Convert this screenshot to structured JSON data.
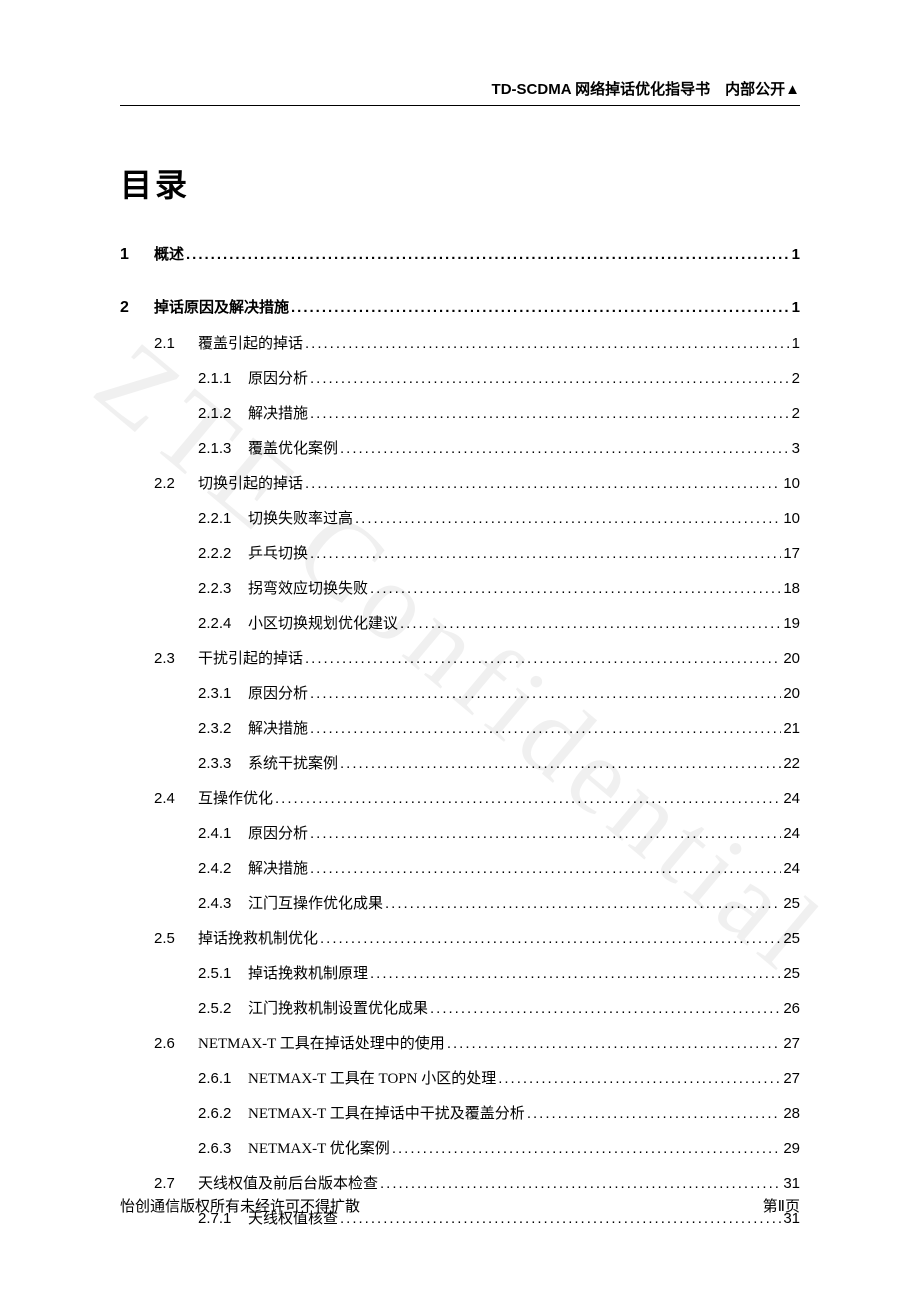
{
  "header": "TD-SCDMA 网络掉话优化指导书　内部公开▲",
  "watermark": "ZTE Confidential",
  "title": "目录",
  "toc": [
    {
      "level": 1,
      "num": "1",
      "label": "概述",
      "page": "1"
    },
    {
      "level": 1,
      "num": "2",
      "label": "掉话原因及解决措施",
      "page": "1"
    },
    {
      "level": 2,
      "num": "2.1",
      "label": "覆盖引起的掉话",
      "page": "1"
    },
    {
      "level": 3,
      "num": "2.1.1",
      "label": "原因分析",
      "page": "2"
    },
    {
      "level": 3,
      "num": "2.1.2",
      "label": "解决措施",
      "page": "2"
    },
    {
      "level": 3,
      "num": "2.1.3",
      "label": "覆盖优化案例",
      "page": "3"
    },
    {
      "level": 2,
      "num": "2.2",
      "label": "切换引起的掉话",
      "page": "10"
    },
    {
      "level": 3,
      "num": "2.2.1",
      "label": "切换失败率过高",
      "page": "10"
    },
    {
      "level": 3,
      "num": "2.2.2",
      "label": "乒乓切换",
      "page": "17"
    },
    {
      "level": 3,
      "num": "2.2.3",
      "label": "拐弯效应切换失败",
      "page": "18"
    },
    {
      "level": 3,
      "num": "2.2.4",
      "label": "小区切换规划优化建议",
      "page": "19"
    },
    {
      "level": 2,
      "num": "2.3",
      "label": "干扰引起的掉话",
      "page": "20"
    },
    {
      "level": 3,
      "num": "2.3.1",
      "label": "原因分析",
      "page": "20"
    },
    {
      "level": 3,
      "num": "2.3.2",
      "label": "解决措施",
      "page": "21"
    },
    {
      "level": 3,
      "num": "2.3.3",
      "label": "系统干扰案例",
      "page": "22"
    },
    {
      "level": 2,
      "num": "2.4",
      "label": "互操作优化",
      "page": "24"
    },
    {
      "level": 3,
      "num": "2.4.1",
      "label": "原因分析",
      "page": "24"
    },
    {
      "level": 3,
      "num": "2.4.2",
      "label": "解决措施",
      "page": "24"
    },
    {
      "level": 3,
      "num": "2.4.3",
      "label": "江门互操作优化成果",
      "page": "25"
    },
    {
      "level": 2,
      "num": "2.5",
      "label": "掉话挽救机制优化",
      "page": "25"
    },
    {
      "level": 3,
      "num": "2.5.1",
      "label": "掉话挽救机制原理",
      "page": "25"
    },
    {
      "level": 3,
      "num": "2.5.2",
      "label": "江门挽救机制设置优化成果",
      "page": "26"
    },
    {
      "level": 2,
      "num": "2.6",
      "label": "NETMAX-T 工具在掉话处理中的使用",
      "page": "27"
    },
    {
      "level": 3,
      "num": "2.6.1",
      "label": "NETMAX-T 工具在 TOPN 小区的处理",
      "page": "27"
    },
    {
      "level": 3,
      "num": "2.6.2",
      "label": "NETMAX-T 工具在掉话中干扰及覆盖分析",
      "page": "28"
    },
    {
      "level": 3,
      "num": "2.6.3",
      "label": "NETMAX-T 优化案例",
      "page": "29"
    },
    {
      "level": 2,
      "num": "2.7",
      "label": "天线权值及前后台版本检查",
      "page": "31"
    },
    {
      "level": 3,
      "num": "2.7.1",
      "label": "天线权值核查",
      "page": "31"
    }
  ],
  "footer": {
    "left": "怡创通信版权所有未经许可不得扩散",
    "right": "第Ⅱ页"
  }
}
